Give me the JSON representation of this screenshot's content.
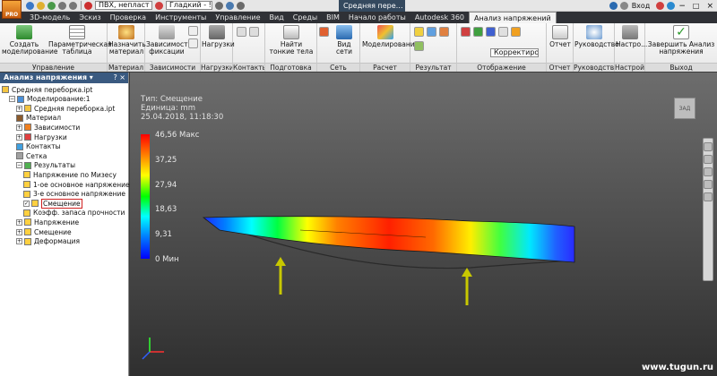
{
  "qat": {
    "app_badge": "PRO",
    "material": "ПВХ, непласт",
    "appearance": "Гладкий - !",
    "doc_title": "Средняя пере…",
    "signin": "Вход"
  },
  "tabs": [
    "3D-модель",
    "Эскиз",
    "Проверка",
    "Инструменты",
    "Управление",
    "Вид",
    "Среды",
    "BIM",
    "Начало работы",
    "Autodesk 360",
    "Анализ напряжений"
  ],
  "ribbon": {
    "buttons": {
      "create_sim": "Создать моделирование",
      "param_table": "Параметрическая таблица",
      "assign_material": "Назначить материал",
      "fix_constraint": "Зависимость фиксации",
      "loads": "Нагрузки",
      "find_thin": "Найти тонкие тела",
      "mesh_view": "Вид сети",
      "simulate": "Моделирование",
      "report": "Отчет",
      "guide": "Руководство",
      "settings": "Настро...",
      "finish": "Завершить Анализ напряжения",
      "adjusters": "Корректиров"
    },
    "groups": [
      "Управление",
      "Материал",
      "Зависимости",
      "Нагрузки",
      "Контакты",
      "Подготовка",
      "Сеть",
      "Расчет",
      "Результат",
      "Отображение",
      "Отчет",
      "Руководство",
      "Настройки",
      "Выход"
    ]
  },
  "browser": {
    "header": "Анализ напряжения",
    "items": [
      {
        "label": "Средняя переборка.ipt",
        "indent": 0,
        "exp": "",
        "color": "#f4c542"
      },
      {
        "label": "Моделирование:1",
        "indent": 1,
        "exp": "−",
        "color": "#4a90d9"
      },
      {
        "label": "Средняя переборка.ipt",
        "indent": 2,
        "exp": "+",
        "color": "#f4c542"
      },
      {
        "label": "Материал",
        "indent": 2,
        "exp": "",
        "color": "#8b5a2b"
      },
      {
        "label": "Зависимости",
        "indent": 2,
        "exp": "+",
        "color": "#f08020"
      },
      {
        "label": "Нагрузки",
        "indent": 2,
        "exp": "+",
        "color": "#e04040"
      },
      {
        "label": "Контакты",
        "indent": 2,
        "exp": "",
        "color": "#40a0e0"
      },
      {
        "label": "Сетка",
        "indent": 2,
        "exp": "",
        "color": "#a0a0a0"
      },
      {
        "label": "Результаты",
        "indent": 2,
        "exp": "−",
        "color": "#50b050"
      },
      {
        "label": "Напряжение по Мизесу",
        "indent": 3,
        "exp": "",
        "color": "#ffd040"
      },
      {
        "label": "1-ое основное напряжение",
        "indent": 3,
        "exp": "",
        "color": "#ffd040"
      },
      {
        "label": "3-е основное напряжение",
        "indent": 3,
        "exp": "",
        "color": "#ffd040"
      },
      {
        "label": "Смещение",
        "indent": 3,
        "exp": "✓",
        "color": "#ffd040",
        "selected": true
      },
      {
        "label": "Коэфф. запаса прочности",
        "indent": 3,
        "exp": "",
        "color": "#ffd040"
      },
      {
        "label": "Напряжение",
        "indent": 2,
        "exp": "+",
        "color": "#ffd040"
      },
      {
        "label": "Смещение",
        "indent": 2,
        "exp": "+",
        "color": "#ffd040"
      },
      {
        "label": "Деформация",
        "indent": 2,
        "exp": "+",
        "color": "#ffd040"
      }
    ]
  },
  "viewport": {
    "type_line": "Тип: Смещение",
    "unit_line": "Единица: mm",
    "date_line": "25.04.2018, 11:18:30",
    "legend": [
      {
        "label": "46,56 Макс",
        "value": 46.56
      },
      {
        "label": "37,25",
        "value": 37.25
      },
      {
        "label": "27,94",
        "value": 27.94
      },
      {
        "label": "18,63",
        "value": 18.63
      },
      {
        "label": "9,31",
        "value": 9.31
      },
      {
        "label": "0 Мин",
        "value": 0
      }
    ],
    "viewcube": "ЗАД",
    "watermark": "www.tugun.ru"
  },
  "colors": {
    "active_tab": "#f3f3f3",
    "browser_head": "#3a5a80",
    "load_arrow": "#c8c800"
  }
}
